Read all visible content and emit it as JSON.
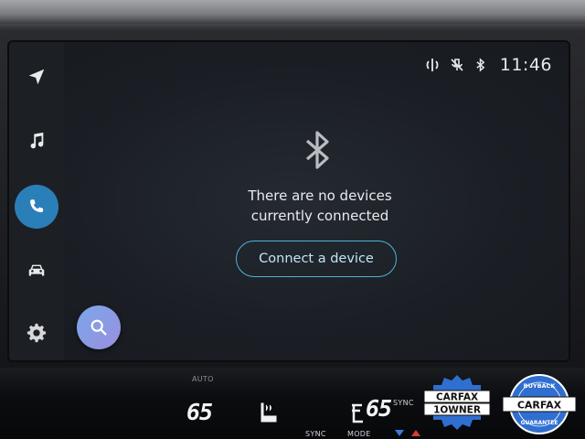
{
  "status_bar": {
    "time": "11:46",
    "icons": [
      "wireless-charging-icon",
      "mic-muted-icon",
      "bluetooth-icon"
    ]
  },
  "sidebar": {
    "items": [
      {
        "name": "navigation",
        "icon": "navigation-arrow-icon",
        "active": false
      },
      {
        "name": "music",
        "icon": "music-note-icon",
        "active": false
      },
      {
        "name": "phone",
        "icon": "phone-icon",
        "active": true
      },
      {
        "name": "vehicle",
        "icon": "car-icon",
        "active": false
      },
      {
        "name": "settings",
        "icon": "gear-icon",
        "active": false
      }
    ]
  },
  "main": {
    "icon": "bluetooth-icon",
    "message_line1": "There are no devices",
    "message_line2": "currently connected",
    "connect_label": "Connect a device"
  },
  "search_button": {
    "icon": "search-icon"
  },
  "console": {
    "left_temp": "65",
    "right_temp": "65",
    "sync_label": "SYNC",
    "sync_bottom": "SYNC",
    "mode_label": "MODE",
    "left_cut": "AUTO"
  },
  "badges": {
    "one_owner": {
      "line1": "CARFAX",
      "line2": "1OWNER"
    },
    "buyback": {
      "top": "BUYBACK",
      "middle": "CARFAX",
      "bottom": "GUARANTEE"
    }
  },
  "colors": {
    "accent": "#2b7fb8",
    "button_border": "#4fb3d9",
    "search_gradient_start": "#7aa7e8",
    "search_gradient_end": "#9a8fe0"
  }
}
